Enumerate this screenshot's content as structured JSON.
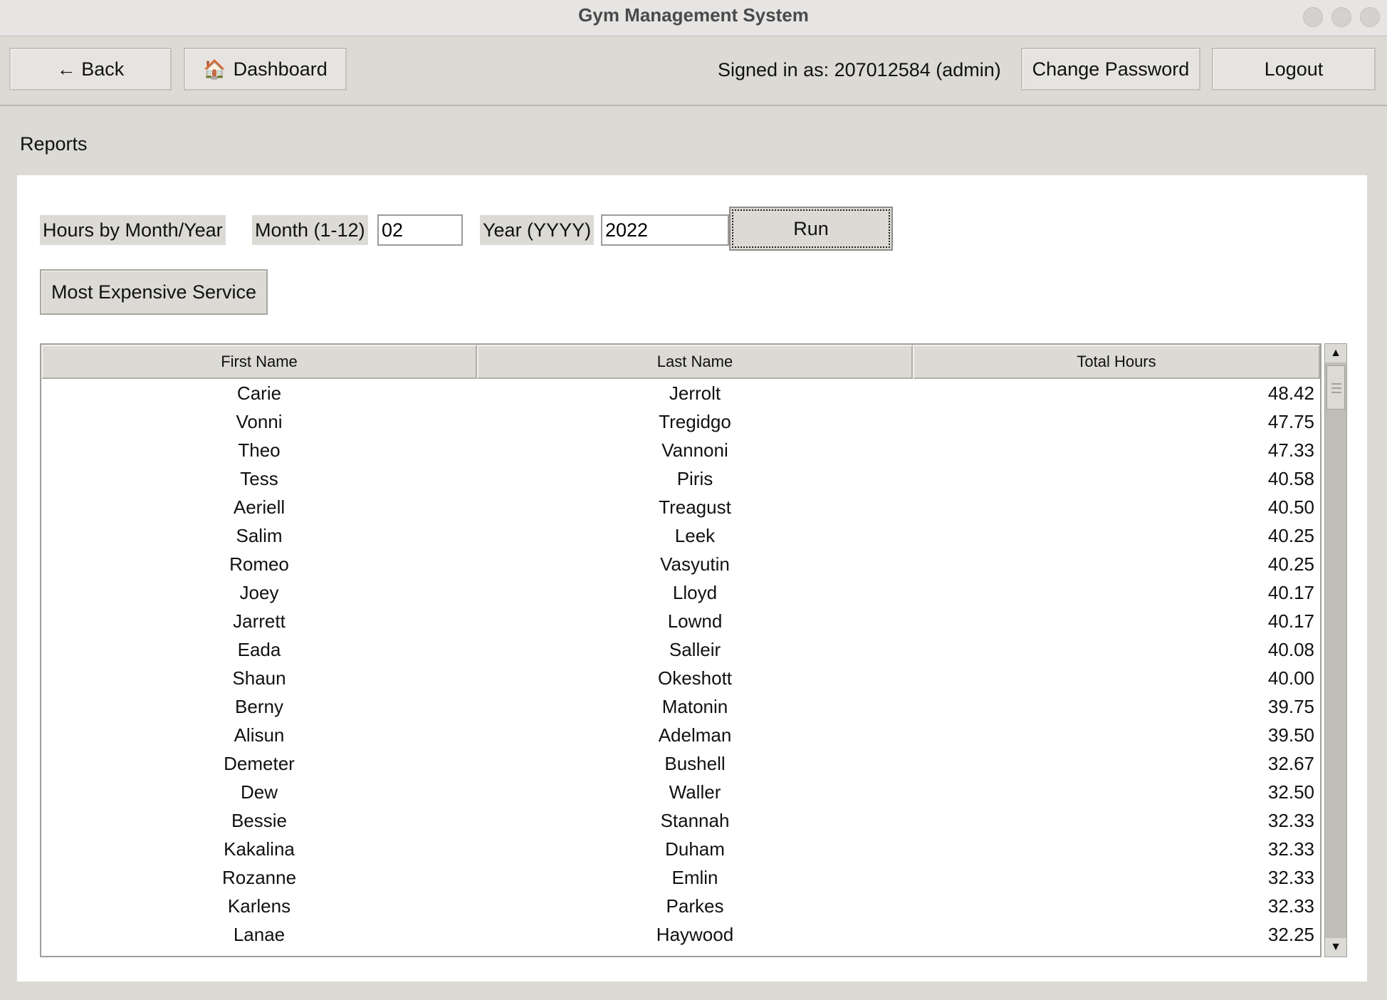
{
  "window": {
    "title": "Gym Management System"
  },
  "toolbar": {
    "back_label": "← Back",
    "dashboard_icon": "🏠",
    "dashboard_label": "Dashboard",
    "signed_in_text": "Signed in as: 207012584 (admin)",
    "change_password_label": "Change Password",
    "logout_label": "Logout"
  },
  "page": {
    "section_title": "Reports"
  },
  "report": {
    "hours_label": "Hours by Month/Year",
    "month_label": "Month (1-12)",
    "month_value": "02",
    "year_label": "Year (YYYY)",
    "year_value": "2022",
    "run_label": "Run",
    "expensive_label": "Most Expensive Service"
  },
  "table": {
    "columns": [
      "First Name",
      "Last Name",
      "Total Hours"
    ],
    "rows": [
      [
        "Carie",
        "Jerrolt",
        "48.42"
      ],
      [
        "Vonni",
        "Tregidgo",
        "47.75"
      ],
      [
        "Theo",
        "Vannoni",
        "47.33"
      ],
      [
        "Tess",
        "Piris",
        "40.58"
      ],
      [
        "Aeriell",
        "Treagust",
        "40.50"
      ],
      [
        "Salim",
        "Leek",
        "40.25"
      ],
      [
        "Romeo",
        "Vasyutin",
        "40.25"
      ],
      [
        "Joey",
        "Lloyd",
        "40.17"
      ],
      [
        "Jarrett",
        "Lownd",
        "40.17"
      ],
      [
        "Eada",
        "Salleir",
        "40.08"
      ],
      [
        "Shaun",
        "Okeshott",
        "40.00"
      ],
      [
        "Berny",
        "Matonin",
        "39.75"
      ],
      [
        "Alisun",
        "Adelman",
        "39.50"
      ],
      [
        "Demeter",
        "Bushell",
        "32.67"
      ],
      [
        "Dew",
        "Waller",
        "32.50"
      ],
      [
        "Bessie",
        "Stannah",
        "32.33"
      ],
      [
        "Kakalina",
        "Duham",
        "32.33"
      ],
      [
        "Rozanne",
        "Emlin",
        "32.33"
      ],
      [
        "Karlens",
        "Parkes",
        "32.33"
      ],
      [
        "Lanae",
        "Haywood",
        "32.25"
      ]
    ]
  },
  "icons": {
    "scroll_up": "▲",
    "scroll_down": "▼"
  }
}
